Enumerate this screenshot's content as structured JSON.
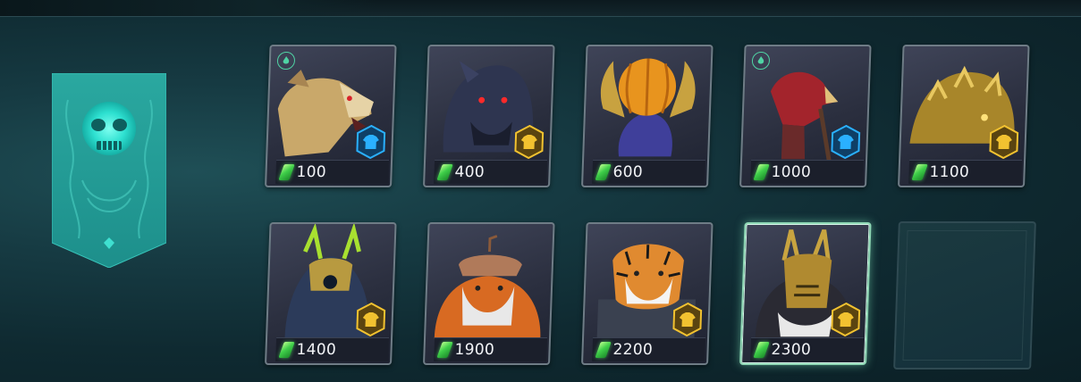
{
  "banner": {
    "emblem": "skull-emblem-icon",
    "rank_icon": "diamond-icon",
    "color": "#2ec9b8"
  },
  "currency_icon": "green-gem-icon",
  "cards": [
    {
      "price": "100",
      "portrait": "wolf-hero",
      "badge": "blue",
      "corner": true,
      "selected": false
    },
    {
      "price": "400",
      "portrait": "werewolf-hero",
      "badge": "gold",
      "corner": false,
      "selected": false
    },
    {
      "price": "600",
      "portrait": "pumpkin-hero",
      "badge": "none",
      "corner": false,
      "selected": false
    },
    {
      "price": "1000",
      "portrait": "red-bird-hero",
      "badge": "blue",
      "corner": true,
      "selected": false
    },
    {
      "price": "1100",
      "portrait": "gold-beast-hero",
      "badge": "gold",
      "corner": false,
      "selected": false
    },
    {
      "price": "1400",
      "portrait": "horned-warrior-hero",
      "badge": "gold",
      "corner": false,
      "selected": false
    },
    {
      "price": "1900",
      "portrait": "monk-hero",
      "badge": "none",
      "corner": false,
      "selected": false
    },
    {
      "price": "2200",
      "portrait": "tiger-hero",
      "badge": "gold",
      "corner": false,
      "selected": false
    },
    {
      "price": "2300",
      "portrait": "gold-knight-hero",
      "badge": "gold",
      "corner": false,
      "selected": true
    }
  ],
  "colors": {
    "badge_blue": "#2ab0ff",
    "badge_gold": "#f2c230",
    "gem": "#3fcf4a",
    "select": "#8fd8b5"
  }
}
